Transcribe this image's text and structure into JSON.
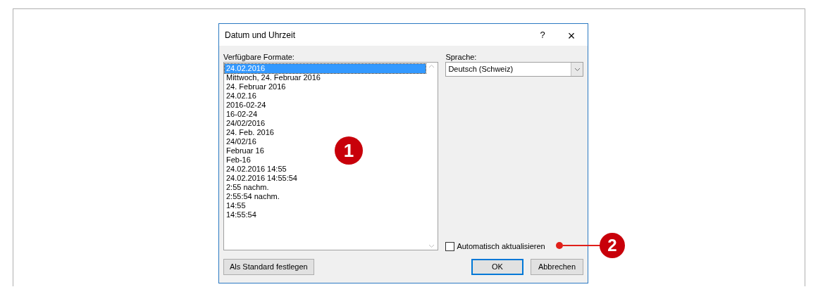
{
  "dialog": {
    "title": "Datum und Uhrzeit",
    "help": "?",
    "close": "×"
  },
  "formats": {
    "label": "Verfügbare Formate:",
    "items": [
      {
        "text": "24.02.2016",
        "selected": true
      },
      {
        "text": "Mittwoch, 24. Februar 2016",
        "selected": false
      },
      {
        "text": "24. Februar 2016",
        "selected": false
      },
      {
        "text": "24.02.16",
        "selected": false
      },
      {
        "text": "2016-02-24",
        "selected": false
      },
      {
        "text": "16-02-24",
        "selected": false
      },
      {
        "text": "24/02/2016",
        "selected": false
      },
      {
        "text": "24. Feb. 2016",
        "selected": false
      },
      {
        "text": "24/02/16",
        "selected": false
      },
      {
        "text": "Februar 16",
        "selected": false
      },
      {
        "text": "Feb-16",
        "selected": false
      },
      {
        "text": "24.02.2016 14:55",
        "selected": false
      },
      {
        "text": "24.02.2016 14:55:54",
        "selected": false
      },
      {
        "text": "2:55 nachm.",
        "selected": false
      },
      {
        "text": "2:55:54 nachm.",
        "selected": false
      },
      {
        "text": "14:55",
        "selected": false
      },
      {
        "text": "14:55:54",
        "selected": false
      }
    ]
  },
  "language": {
    "label": "Sprache:",
    "value": "Deutsch (Schweiz)"
  },
  "auto_update": {
    "label": "Automatisch aktualisieren",
    "checked": false
  },
  "buttons": {
    "set_default": "Als Standard festlegen",
    "ok": "OK",
    "cancel": "Abbrechen"
  },
  "callouts": [
    {
      "number": "1"
    },
    {
      "number": "2"
    }
  ]
}
